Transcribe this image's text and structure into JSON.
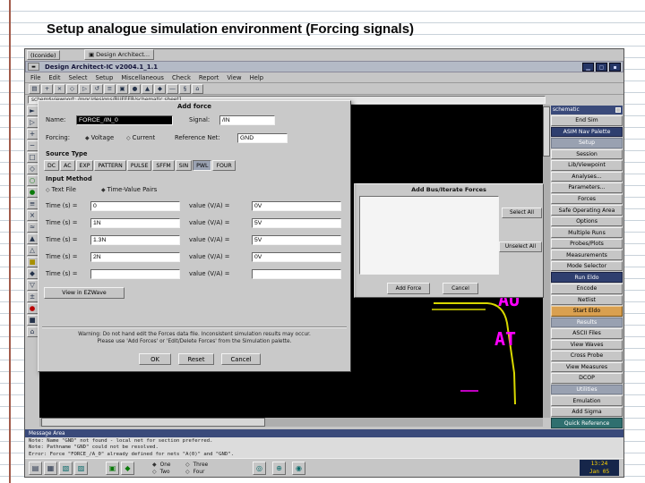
{
  "slide": {
    "title": "Setup analogue simulation environment (Forcing signals)"
  },
  "taskbar": {
    "iconified_label": "(Iconide)",
    "window_tab": "Design Architect..."
  },
  "window": {
    "title": "Design Architect-IC v2004.1_1.1",
    "menus": [
      "File",
      "Edit",
      "Select",
      "Setup",
      "Miscellaneous",
      "Check",
      "Report",
      "View",
      "Help"
    ],
    "path_value": "schem$viewport: /mgc/designs/BUFFER/schematic  sheet1"
  },
  "icons": {
    "app": "▣",
    "win_menu": "▬",
    "win_min": "▁",
    "win_max": "▢",
    "close": "▪",
    "radio_on": "◆",
    "radio_off": "◇",
    "globe_a": "◎",
    "globe_b": "⊕",
    "globe_c": "◉"
  },
  "top_tools": [
    {
      "g": "▤"
    },
    {
      "g": "+"
    },
    {
      "g": "×"
    },
    {
      "g": "◇"
    },
    {
      "g": "▷"
    },
    {
      "g": "↺"
    },
    {
      "g": "≡"
    },
    {
      "g": "▣"
    },
    {
      "g": "●"
    },
    {
      "g": "▲"
    },
    {
      "g": "◆"
    },
    {
      "g": "―"
    },
    {
      "g": "§"
    },
    {
      "g": "⌂"
    }
  ],
  "left_tools": [
    {
      "g": "►"
    },
    {
      "g": "▷"
    },
    {
      "g": "+"
    },
    {
      "g": "─"
    },
    {
      "g": "□"
    },
    {
      "g": "◇"
    },
    {
      "g": "○"
    },
    {
      "g": "●"
    },
    {
      "g": "≡"
    },
    {
      "g": "×"
    },
    {
      "g": "≈"
    },
    {
      "g": "▲"
    },
    {
      "g": "△"
    },
    {
      "g": "■"
    },
    {
      "g": "◆"
    },
    {
      "g": "▽"
    },
    {
      "g": "±"
    },
    {
      "g": "●"
    },
    {
      "g": "■"
    },
    {
      "g": "⌂"
    }
  ],
  "force_dialog": {
    "title": "Add force",
    "name_label": "Name:",
    "name_value": "FORCE_/IN_0",
    "signal_label": "Signal:",
    "signal_value": "/IN",
    "forcing_label": "Forcing:",
    "voltage_label": "Voltage",
    "current_label": "Current",
    "refnet_label": "Reference Net:",
    "refnet_value": "GND",
    "source_type_label": "Source Type",
    "tabs": [
      "DC",
      "AC",
      "EXP",
      "PATTERN",
      "PULSE",
      "SFFM",
      "SIN",
      "PWL",
      "FOUR"
    ],
    "active_tab": "PWL",
    "input_method_label": "Input Method",
    "text_file_label": "Text File",
    "pairs_label": "Time-Value Pairs",
    "time_label": "Time (s) =",
    "value_label": "value (V/A) =",
    "rows": [
      {
        "t": "0",
        "v": "0V"
      },
      {
        "t": "1N",
        "v": "5V"
      },
      {
        "t": "1.3N",
        "v": "5V"
      },
      {
        "t": "2N",
        "v": "0V"
      },
      {
        "t": "",
        "v": ""
      }
    ],
    "ezwave_button": "View in EZWave",
    "warning_line1": "Warning: Do not hand edit the Forces data file. Inconsistent simulation results may occur.",
    "warning_line2": "Please use 'Add Forces' or 'Edit/Delete Forces' from the Simulation palette.",
    "ok": "OK",
    "reset": "Reset",
    "cancel": "Cancel"
  },
  "bus_panel": {
    "title": "Add Bus/Iterate Forces",
    "select_all": "Select All",
    "unselect_all": "Unselect All",
    "add_force": "Add Force",
    "cancel": "Cancel"
  },
  "palette": {
    "titlebar": "schematic",
    "items": [
      {
        "label": "End Sim"
      },
      {
        "label": "ASIM Nav Palette"
      },
      {
        "label": "Setup"
      },
      {
        "label": "Session"
      },
      {
        "label": "Lib/Viewpoint"
      },
      {
        "label": "Analyses..."
      },
      {
        "label": "Parameters..."
      },
      {
        "label": "Forces"
      },
      {
        "label": "Safe Operating Area"
      },
      {
        "label": "Options"
      },
      {
        "label": "Multiple Runs"
      },
      {
        "label": "Probes/Plots"
      },
      {
        "label": "Measurements"
      },
      {
        "label": "Mode Selector"
      },
      {
        "label": "Run Eldo"
      },
      {
        "label": "Encode"
      },
      {
        "label": "Netlist"
      },
      {
        "label": "Start Eldo"
      },
      {
        "label": "Results"
      },
      {
        "label": "ASCII Files"
      },
      {
        "label": "View Waves"
      },
      {
        "label": "Cross Probe"
      },
      {
        "label": "View Measures"
      },
      {
        "label": "DCOP"
      },
      {
        "label": "Utilities"
      },
      {
        "label": "Emulation"
      },
      {
        "label": "Add Sigma"
      },
      {
        "label": "Quick Reference"
      }
    ]
  },
  "canvas": {
    "label_top": "AU",
    "label_bottom": "AT"
  },
  "messages": {
    "bar_title": "Message Area",
    "lines": [
      "Note: Name \"GND\" not found - local net for section preferred.",
      "Note: Pathname \"GND\" could not be resolved.",
      "Error: Force \"FORCE_/A_0\" already defined for nets \"A(0)\" and \"GND\"."
    ]
  },
  "statusbar_icons": [
    {
      "g": "▤"
    },
    {
      "g": "▦"
    },
    {
      "g": "▧"
    },
    {
      "g": "▨"
    },
    {
      "g": "▣"
    },
    {
      "g": "◆"
    }
  ],
  "statusbar": {
    "sheet_options": [
      "One",
      "Two",
      "Three",
      "Four"
    ],
    "clock_time": "13:24",
    "clock_date": "Jan 05"
  },
  "colors": {
    "highlight_button": "#d9a050",
    "canvas_text": "#ff00ff",
    "canvas_shape": "#d8d800",
    "clock_text": "#ffd400",
    "margin_line": "#a25a4a",
    "rule_line": "#c9d2da"
  }
}
